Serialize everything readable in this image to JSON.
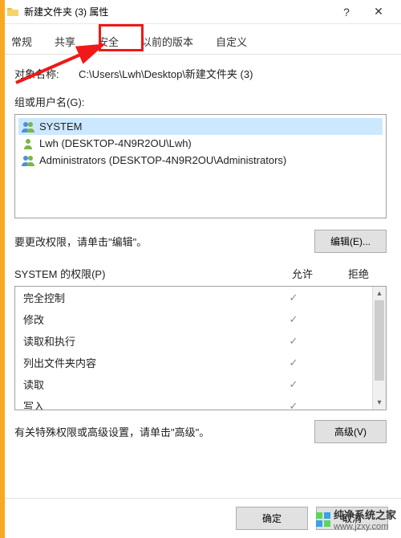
{
  "titlebar": {
    "title": "新建文件夹 (3) 属性"
  },
  "tabs": {
    "general": "常规",
    "share": "共享",
    "security": "安全",
    "prev": "以前的版本",
    "custom": "自定义"
  },
  "object": {
    "label": "对象名称:",
    "value": "C:\\Users\\Lwh\\Desktop\\新建文件夹 (3)"
  },
  "groups": {
    "label": "组或用户名(G):",
    "items": [
      {
        "name": "SYSTEM"
      },
      {
        "name": "Lwh (DESKTOP-4N9R2OU\\Lwh)"
      },
      {
        "name": "Administrators (DESKTOP-4N9R2OU\\Administrators)"
      }
    ]
  },
  "edit": {
    "text": "要更改权限，请单击\"编辑\"。",
    "button": "编辑(E)..."
  },
  "perms": {
    "title": "SYSTEM 的权限(P)",
    "allow": "允许",
    "deny": "拒绝",
    "rows": [
      {
        "name": "完全控制",
        "allow": "✓"
      },
      {
        "name": "修改",
        "allow": "✓"
      },
      {
        "name": "读取和执行",
        "allow": "✓"
      },
      {
        "name": "列出文件夹内容",
        "allow": "✓"
      },
      {
        "name": "读取",
        "allow": "✓"
      },
      {
        "name": "写入",
        "allow": "✓"
      }
    ]
  },
  "advanced": {
    "text": "有关特殊权限或高级设置，请单击\"高级\"。",
    "button": "高级(V)"
  },
  "buttons": {
    "ok": "确定",
    "cancel": "取消"
  },
  "watermark": {
    "name": "纯净系统之家",
    "url": "www.jzxy.com"
  }
}
